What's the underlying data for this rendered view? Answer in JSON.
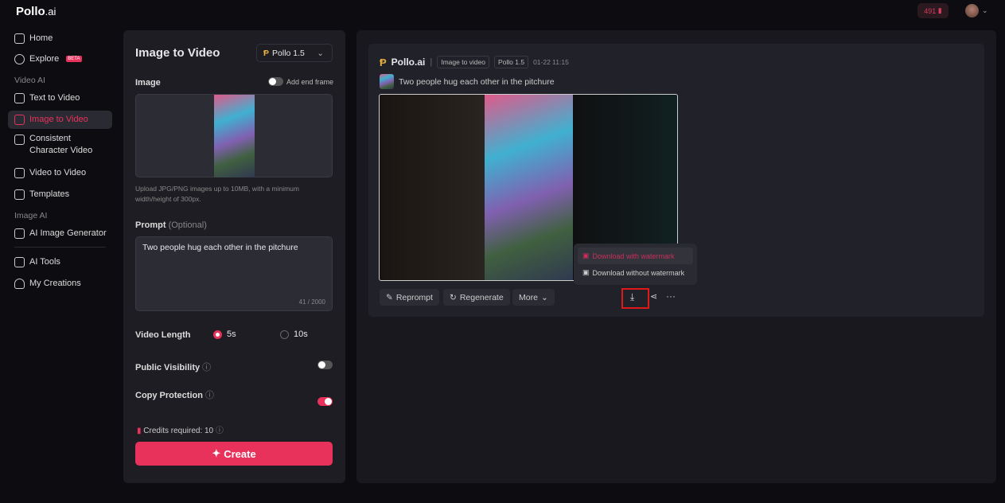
{
  "brand": {
    "name": "Pollo",
    "suffix": ".ai"
  },
  "topbar": {
    "credits": "491",
    "accent": "#e8325c"
  },
  "sidebar": {
    "items": [
      {
        "label": "Home"
      },
      {
        "label": "Explore",
        "badge": "BETA"
      }
    ],
    "video_ai_label": "Video AI",
    "video_items": [
      {
        "label": "Text to Video"
      },
      {
        "label": "Image to Video"
      },
      {
        "label": "Consistent Character Video"
      },
      {
        "label": "Video to Video"
      },
      {
        "label": "Templates"
      }
    ],
    "image_ai_label": "Image AI",
    "image_items": [
      {
        "label": "AI Image Generator"
      }
    ],
    "bottom_items": [
      {
        "label": "AI Tools"
      },
      {
        "label": "My Creations"
      }
    ]
  },
  "form": {
    "title": "Image to Video",
    "model": "Pollo 1.5",
    "image_label": "Image",
    "end_frame_label": "Add end frame",
    "upload_hint": "Upload JPG/PNG images up to 10MB, with a minimum width/height of 300px.",
    "prompt_label": "Prompt",
    "prompt_optional": "(Optional)",
    "prompt_value": "Two people hug each other in the pitchure",
    "prompt_count": "41 / 2000",
    "video_length_label": "Video Length",
    "length_options": [
      "5s",
      "10s"
    ],
    "public_visibility_label": "Public Visibility",
    "public_visibility_on": false,
    "copy_protection_label": "Copy Protection",
    "copy_protection_on": true,
    "credits_required": "Credits required: 10",
    "create_label": "Create"
  },
  "result": {
    "brand": "Pollo.ai",
    "tag_mode": "Image to video",
    "tag_model": "Pollo 1.5",
    "timestamp": "01-22 11:15",
    "prompt": "Two people hug each other in the pitchure",
    "actions": {
      "reprompt": "Reprompt",
      "regenerate": "Regenerate",
      "more": "More"
    },
    "download_menu": [
      "Download with watermark",
      "Download without watermark"
    ]
  }
}
